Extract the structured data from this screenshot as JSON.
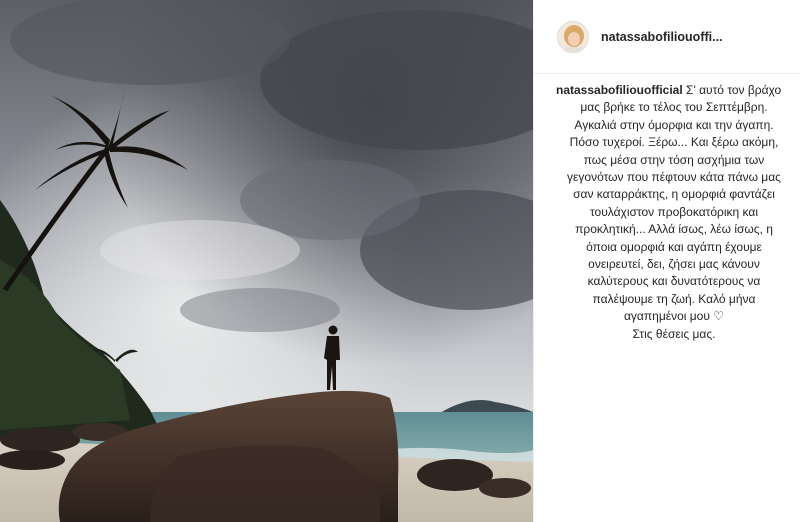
{
  "post": {
    "username_header": "natassabofiliouoffi...",
    "caption": {
      "username": "natassabofiliouofficial",
      "lines_first": " Σ' αυτό τον βράχο",
      "lines": [
        "μας βρήκε το τέλος του Σεπτέμβρη.",
        "Αγκαλιά στην όμορφια και την άγαπη.",
        "Πόσο τυχεροί. Ξέρω... Και ξέρω ακόμη,",
        "πως μέσα στην τόση ασχήμια των",
        "γεγονότων που πέφτουν κάτα πάνω μας",
        "σαν καταρράκτης, η ομορφιά φαντάζει",
        "τουλάχιστον προβοκατόρικη και",
        "προκλητική... Αλλά ίσως, λέω ίσως, η",
        "όποια ομορφιά και αγάπη έχουμε",
        "ονειρευτεί, δει, ζήσει μας κάνουν",
        "καλύτερους και δυνατότερους να",
        "παλέψουμε τη ζωή. Καλό μήνα",
        "αγαπημένοι μου ♡",
        "Στις θέσεις μας."
      ]
    }
  }
}
